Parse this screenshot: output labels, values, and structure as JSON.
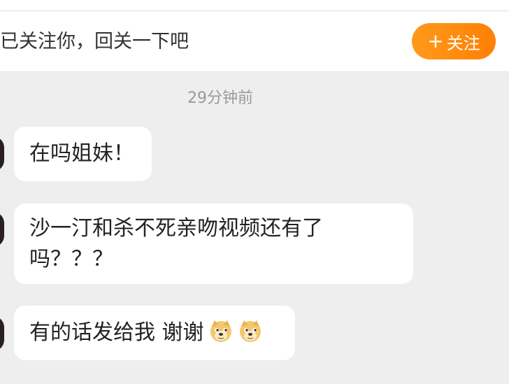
{
  "follow_bar": {
    "message": "已关注你，回关一下吧",
    "button_label": "关注",
    "button_icon": "plus-icon"
  },
  "timestamp": "29分钟前",
  "messages": [
    {
      "text": "在吗姐妹！"
    },
    {
      "text": "沙一汀和杀不死亲吻视频还有了吗？？？"
    },
    {
      "text": "有的话发给我 谢谢",
      "emoji": [
        "doge-emoji",
        "doge-emoji"
      ]
    }
  ],
  "colors": {
    "accent": "#ff8a0e",
    "background": "#eeeeee",
    "bubble": "#ffffff"
  }
}
